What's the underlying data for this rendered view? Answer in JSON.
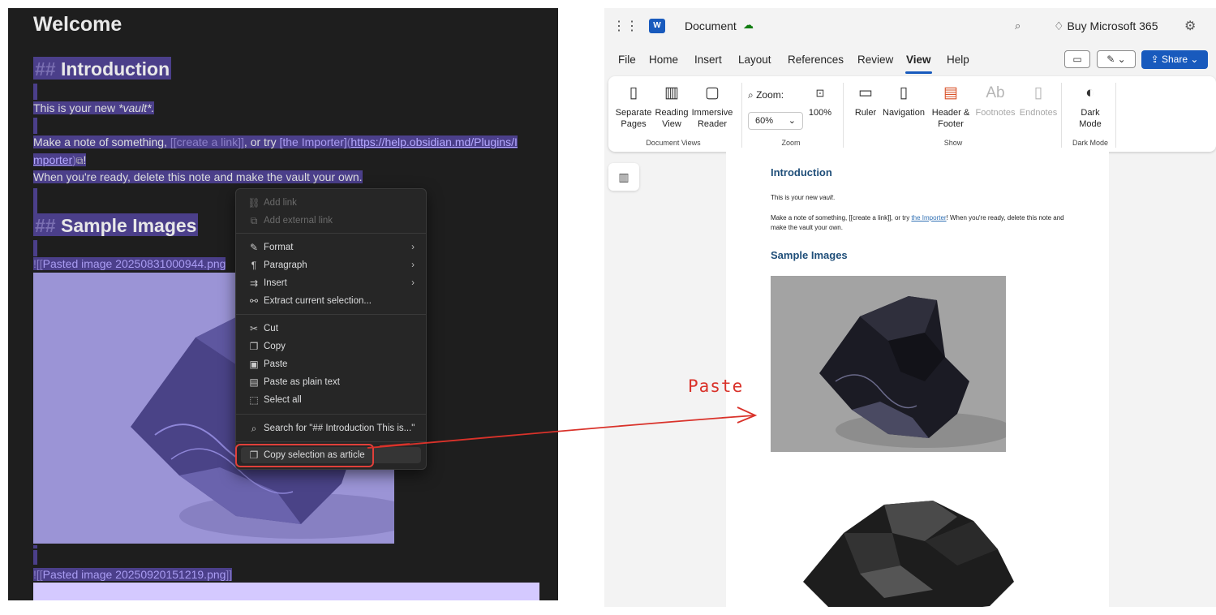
{
  "obsidian": {
    "title": "Welcome",
    "intro_hash": "##",
    "intro_heading": "Introduction",
    "line1_pre": "This is your new ",
    "line1_em": "*vault*.",
    "line2_pre": "Make a note of something, ",
    "line2_link": "[[create a link]]",
    "line2_mid": ", or try ",
    "line2_md": "[the Importer]",
    "line2_url1": "https://help.obsidian.md/Plugins/I",
    "line3_url2": "mporter",
    "line3_tail": "!",
    "line4": "When you're ready, delete this note and make the vault your own.",
    "sample_hash": "##",
    "sample_heading": "Sample Images",
    "embed1_pre": "![[",
    "embed1_name": "Pasted image 20250831000944.png",
    "embed2_pre": "![[",
    "embed2_name": "Pasted image 20250920151219.png",
    "embed2_post": "]]",
    "context_menu": {
      "items": [
        {
          "icon": "link-icon",
          "label": "Add link",
          "disabled": true
        },
        {
          "icon": "external-link-icon",
          "label": "Add external link",
          "disabled": true
        },
        {
          "icon": "brush-icon",
          "label": "Format",
          "submenu": true
        },
        {
          "icon": "pilcrow-icon",
          "label": "Paragraph",
          "submenu": true
        },
        {
          "icon": "insert-icon",
          "label": "Insert",
          "submenu": true
        },
        {
          "icon": "extract-icon",
          "label": "Extract current selection..."
        },
        {
          "icon": "scissors-icon",
          "label": "Cut"
        },
        {
          "icon": "copy-icon",
          "label": "Copy"
        },
        {
          "icon": "clipboard-icon",
          "label": "Paste"
        },
        {
          "icon": "clipboard-text-icon",
          "label": "Paste as plain text"
        },
        {
          "icon": "select-all-icon",
          "label": "Select all"
        },
        {
          "icon": "search-icon",
          "label": "Search for \"## Introduction This is...\""
        },
        {
          "icon": "copy-icon",
          "label": "Copy selection as article",
          "highlighted": true
        }
      ]
    }
  },
  "annotation": {
    "label": "Paste",
    "color": "#d9322a"
  },
  "word": {
    "doc_title": "Document",
    "buy_label": "Buy Microsoft 365",
    "tabs": [
      "File",
      "Home",
      "Insert",
      "Layout",
      "References",
      "Review",
      "View",
      "Help"
    ],
    "active_tab": "View",
    "share_label": "Share",
    "ribbon": {
      "separate_pages": [
        "Separate",
        "Pages"
      ],
      "reading_view": [
        "Reading",
        "View"
      ],
      "immersive_reader": [
        "Immersive",
        "Reader"
      ],
      "group_document_views": "Document Views",
      "zoom_label": "Zoom:",
      "zoom_value": "60%",
      "zoom_100": "100%",
      "group_zoom": "Zoom",
      "ruler": "Ruler",
      "navigation": "Navigation",
      "header_footer": [
        "Header &",
        "Footer"
      ],
      "footnotes": "Footnotes",
      "endnotes": "Endnotes",
      "group_show": "Show",
      "dark_mode": [
        "Dark",
        "Mode"
      ],
      "group_dark_mode": "Dark Mode"
    },
    "page": {
      "heading1": "Introduction",
      "p1_pre": "This is your new ",
      "p1_em": "vault",
      "p1_post": ".",
      "p2_pre": "Make a note of something, [[create a link]], or try ",
      "p2_link": "the Importer",
      "p2_post": "! When you're ready, delete this note and make the vault your own.",
      "heading2": "Sample Images"
    },
    "accent": "#185abd"
  }
}
